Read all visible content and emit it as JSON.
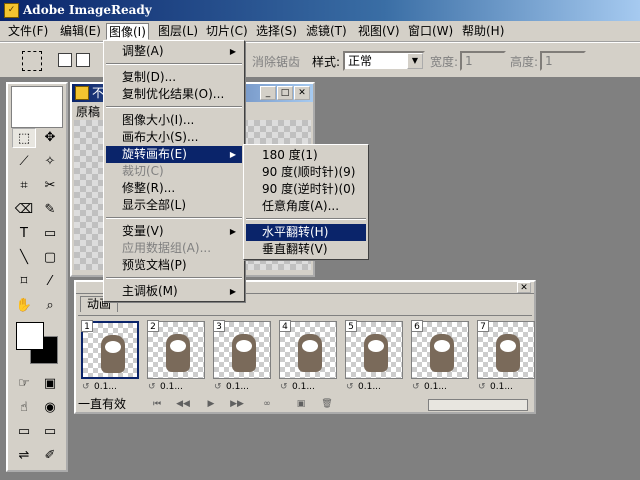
{
  "window": {
    "title": "Adobe ImageReady",
    "icon": "imageready-app-icon"
  },
  "menubar": {
    "items": [
      "文件(F)",
      "编辑(E)",
      "图像(I)",
      "图层(L)",
      "切片(C)",
      "选择(S)",
      "滤镜(T)",
      "视图(V)",
      "窗口(W)",
      "帮助(H)"
    ],
    "active": "图像(I)"
  },
  "options": {
    "antialias_label": "消除锯齿",
    "style_label": "样式:",
    "style_value": "正常",
    "width_label": "宽度:",
    "width_value": "1",
    "height_label": "高度:",
    "height_value": "1"
  },
  "image_menu": {
    "items": [
      "调整(A)",
      "复制(D)...",
      "复制优化结果(O)...",
      "图像大小(I)...",
      "画布大小(S)...",
      "旋转画布(E)",
      "裁切(C)",
      "修整(R)...",
      "显示全部(L)",
      "变量(V)",
      "应用数据组(A)...",
      "预览文档(P)",
      "主调板(M)"
    ]
  },
  "rotate_submenu": {
    "items": [
      "180 度(1)",
      "90 度(顺时针)(9)",
      "90 度(逆时针)(0)",
      "任意角度(A)...",
      "水平翻转(H)",
      "垂直翻转(V)"
    ]
  },
  "doc_window": {
    "title": "不",
    "tab": "原稿"
  },
  "anim_panel": {
    "tab": "动画",
    "frames": [
      {
        "num": "1",
        "delay": "0.1..."
      },
      {
        "num": "2",
        "delay": "0.1..."
      },
      {
        "num": "3",
        "delay": "0.1..."
      },
      {
        "num": "4",
        "delay": "0.1..."
      },
      {
        "num": "5",
        "delay": "0.1..."
      },
      {
        "num": "6",
        "delay": "0.1..."
      },
      {
        "num": "7",
        "delay": "0.1..."
      }
    ],
    "loop": "一直有效"
  }
}
